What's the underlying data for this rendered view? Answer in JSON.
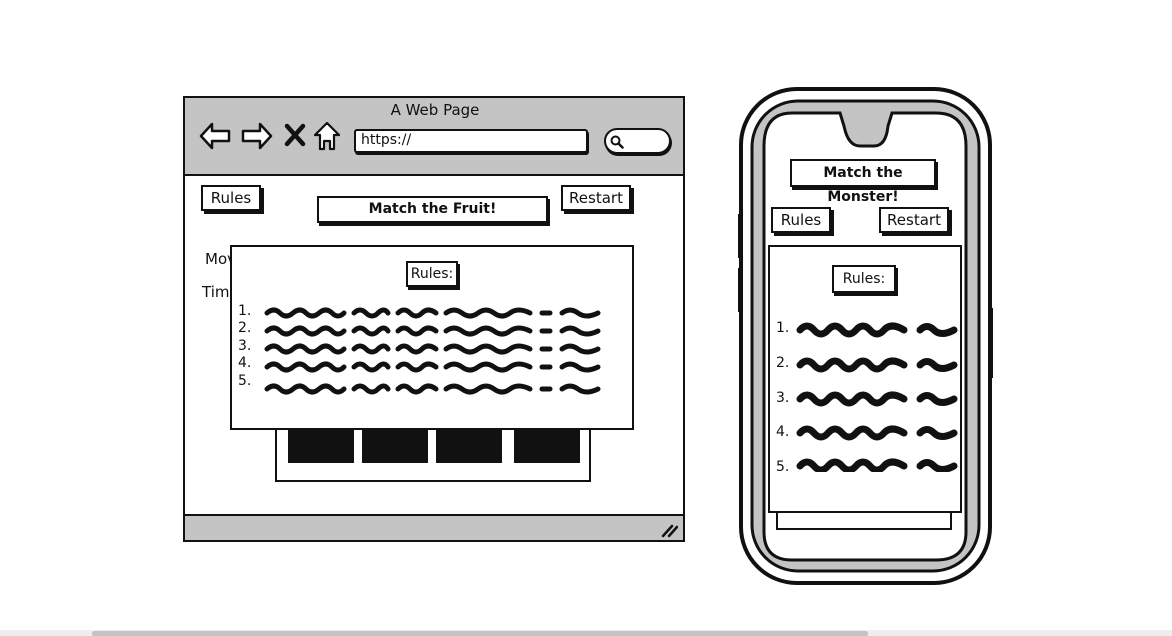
{
  "browser": {
    "window_title": "A Web Page",
    "url_text": "https://",
    "icons": [
      "back-arrow-icon",
      "forward-arrow-icon",
      "close-x-icon",
      "home-icon",
      "search-icon",
      "resize-grip-icon"
    ]
  },
  "desktop": {
    "rules_label": "Rules",
    "restart_label": "Restart",
    "title": "Match the Fruit!",
    "moves_label_fragment": "Mov",
    "time_label_fragment": "Time",
    "modal_title": "Rules:",
    "rule_numbers": [
      "1.",
      "2.",
      "3.",
      "4.",
      "5."
    ]
  },
  "mobile": {
    "title": "Match the Monster!",
    "rules_label": "Rules",
    "restart_label": "Restart",
    "modal_title": "Rules:",
    "rule_numbers": [
      "1.",
      "2.",
      "3.",
      "4.",
      "5."
    ]
  },
  "colors": {
    "chrome_gray": "#c4c4c4",
    "ink": "#111111",
    "paper": "#ffffff"
  }
}
